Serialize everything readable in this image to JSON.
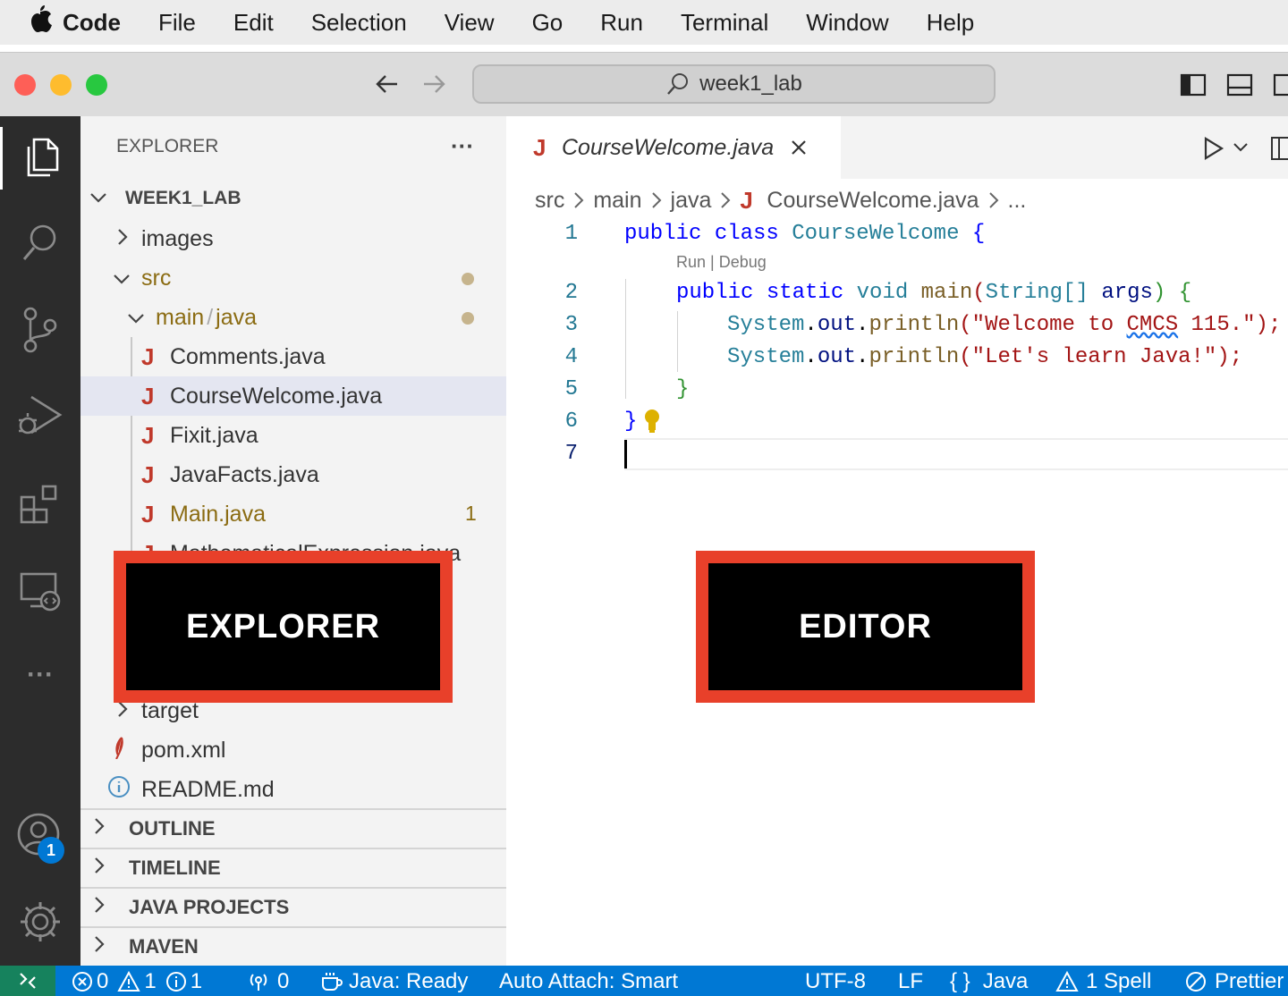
{
  "menubar": {
    "app": "Code",
    "items": [
      "File",
      "Edit",
      "Selection",
      "View",
      "Go",
      "Run",
      "Terminal",
      "Window",
      "Help"
    ]
  },
  "titlebar": {
    "search": "week1_lab"
  },
  "activity": {
    "account_badge": "1"
  },
  "explorer": {
    "title": "EXPLORER",
    "more": "···",
    "root": "WEEK1_LAB",
    "rows": {
      "images": "images",
      "src": "src",
      "main": "main",
      "slash": "/",
      "java": "java",
      "f1": "Comments.java",
      "f2": "CourseWelcome.java",
      "f3": "Fixit.java",
      "f4": "JavaFacts.java",
      "f5": "Main.java",
      "f5_badge": "1",
      "f6": "MathematicalExpression.java",
      "target": "target",
      "pom": "pom.xml",
      "readme": "README.md"
    },
    "sections": [
      "OUTLINE",
      "TIMELINE",
      "JAVA PROJECTS",
      "MAVEN"
    ]
  },
  "editor": {
    "tab": "CourseWelcome.java",
    "breadcrumb": [
      "src",
      "main",
      "java",
      "CourseWelcome.java",
      "..."
    ],
    "codelens": "Run | Debug",
    "lines": [
      "1",
      "2",
      "3",
      "4",
      "5",
      "6",
      "7"
    ],
    "code": {
      "l1a": "public class ",
      "l1b": "CourseWelcome",
      "l1c": " {",
      "l2a": "public static ",
      "l2b": "void ",
      "l2c": "main",
      "l2d": "(",
      "l2e": "String",
      "l2f": "[] ",
      "l2g": "args",
      "l2h": ") {",
      "l3a": "System",
      "l3b": ".",
      "l3c": "out",
      "l3d": ".",
      "l3e": "println",
      "l3f": "(\"Welcome to ",
      "l3g": "CMCS",
      "l3h": " 115.\");",
      "l4a": "System",
      "l4b": ".",
      "l4c": "out",
      "l4d": ".",
      "l4e": "println",
      "l4f": "(\"Let's learn Java!\");",
      "l5": "}",
      "l6": "}"
    }
  },
  "overlays": {
    "explorer": "EXPLORER",
    "editor": "EDITOR"
  },
  "statusbar": {
    "errors": "0",
    "warnings": "1",
    "infos": "1",
    "ports": "0",
    "java": "Java: Ready",
    "attach": "Auto Attach: Smart",
    "encoding": "UTF-8",
    "eol": "LF",
    "lang_braces": "{ }",
    "lang": "Java",
    "spell": "1 Spell",
    "prettier": "Prettier"
  }
}
